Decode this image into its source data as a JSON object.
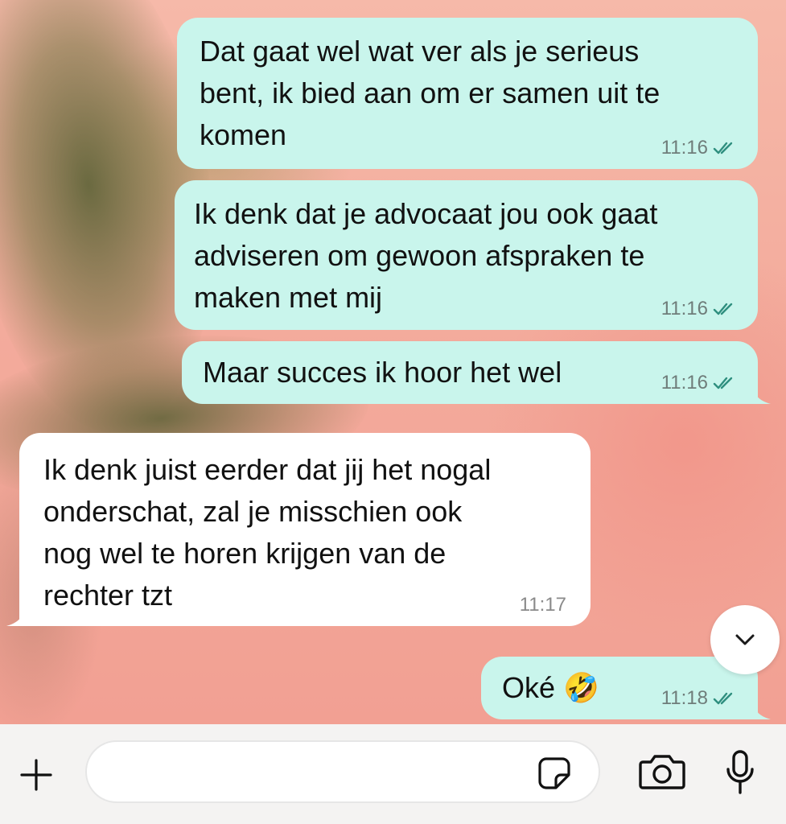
{
  "chat": {
    "messages": [
      {
        "direction": "out",
        "text": "Dat gaat wel wat ver als je serieus\nbent, ik bied aan om er samen uit te\nkomen",
        "time": "11:16",
        "status": "read"
      },
      {
        "direction": "out",
        "text": "Ik denk dat je advocaat jou ook gaat\nadviseren om gewoon afspraken te\nmaken met mij",
        "time": "11:16",
        "status": "read"
      },
      {
        "direction": "out",
        "text": "Maar succes ik hoor het wel",
        "time": "11:16",
        "status": "read"
      },
      {
        "direction": "in",
        "text": "Ik denk juist eerder dat jij het nogal\nonderschat, zal je misschien ook\nnog wel te horen krijgen van de\nrechter tzt",
        "time": "11:17"
      },
      {
        "direction": "out",
        "text": "Oké 🤣",
        "time": "11:18",
        "status": "read"
      }
    ],
    "scroll_down_icon": "chevron-down-icon"
  },
  "composer": {
    "input_value": "",
    "icons": {
      "attach": "plus-icon",
      "sticker": "sticker-icon",
      "camera": "camera-icon",
      "mic": "microphone-icon"
    }
  },
  "colors": {
    "outgoing_bubble": "#c9f5ec",
    "incoming_bubble": "#ffffff",
    "read_ticks": "#2f8f7f",
    "composer_bg": "#f4f3f2"
  }
}
